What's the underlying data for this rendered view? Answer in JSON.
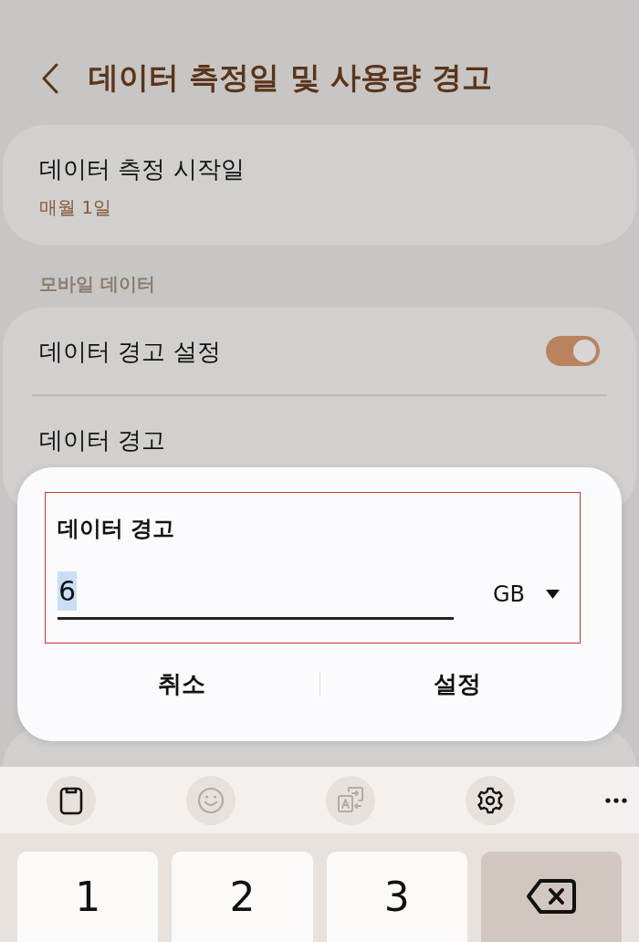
{
  "header": {
    "title": "데이터 측정일 및 사용량 경고"
  },
  "start_day": {
    "title": "데이터 측정 시작일",
    "value": "매월 1일"
  },
  "mobile_data": {
    "title": "모바일 데이터",
    "rows": [
      {
        "kind": "toggle",
        "label": "데이터 경고 설정",
        "on": true
      },
      {
        "kind": "value",
        "label": "데이터 경고"
      }
    ]
  },
  "dialog": {
    "title": "데이터 경고",
    "highlighted": true,
    "input": {
      "value": "6",
      "text_selected": true
    },
    "unit": "GB",
    "buttons": [
      {
        "label": "취소"
      },
      {
        "label": "설정"
      }
    ]
  },
  "keyboard": {
    "toolbar": [
      {
        "kind": "clipboard",
        "disabled": false
      },
      {
        "kind": "emoji",
        "disabled": true
      },
      {
        "kind": "translate",
        "disabled": true
      },
      {
        "kind": "settings",
        "disabled": false
      },
      {
        "kind": "more",
        "disabled": false
      }
    ],
    "keys": [
      {
        "kind": "digit",
        "label": "1"
      },
      {
        "kind": "digit",
        "label": "2"
      },
      {
        "kind": "digit",
        "label": "3"
      },
      {
        "kind": "backspace"
      }
    ]
  }
}
